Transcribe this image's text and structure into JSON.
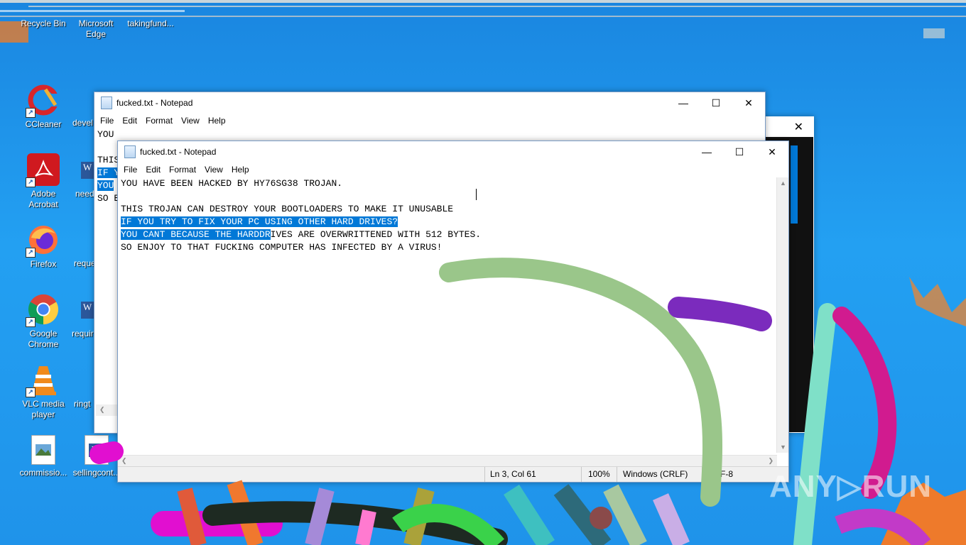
{
  "desktop": {
    "icons": [
      {
        "label": "Recycle Bin",
        "icon": "recycle-bin-icon"
      },
      {
        "label": "Microsoft Edge",
        "icon": "edge-icon"
      },
      {
        "label": "takingfund...",
        "icon": "word-document-icon"
      },
      {
        "label": "CCleaner",
        "icon": "ccleaner-icon"
      },
      {
        "label": "Adobe Acrobat",
        "icon": "acrobat-icon"
      },
      {
        "label": "Firefox",
        "icon": "firefox-icon"
      },
      {
        "label": "Google Chrome",
        "icon": "chrome-icon"
      },
      {
        "label": "VLC media player",
        "icon": "vlc-icon"
      },
      {
        "label": "commissio...",
        "icon": "image-file-icon"
      },
      {
        "label": "sellingcont...",
        "icon": "word-document-icon"
      }
    ],
    "partial_labels": [
      "devel",
      "need",
      "reque",
      "requir",
      "ringt"
    ]
  },
  "back_window": {
    "title": "fucked.txt - Notepad",
    "menu": [
      "File",
      "Edit",
      "Format",
      "View",
      "Help"
    ],
    "lines": [
      "YOU",
      "",
      "THIS",
      "IF Y",
      "YOU",
      "SO E"
    ]
  },
  "front_window": {
    "title": "fucked.txt - Notepad",
    "menu": [
      "File",
      "Edit",
      "Format",
      "View",
      "Help"
    ],
    "lines": [
      {
        "text": "YOU HAVE BEEN HACKED BY HY76SG38 TROJAN.",
        "selected": "",
        "rest": ""
      },
      {
        "text": "",
        "selected": "",
        "rest": ""
      },
      {
        "text": "THIS TROJAN CAN DESTROY YOUR BOOTLOADERS TO MAKE IT UNUSABLE",
        "selected": "",
        "rest": ""
      },
      {
        "text": "",
        "selected": "IF YOU TRY TO FIX YOUR PC USING OTHER HARD DRIVES?",
        "rest": ""
      },
      {
        "text": "",
        "selected": "YOU CANT BECAUSE THE HARDDR",
        "rest": "IVES ARE OVERWRITTENED WITH 512 BYTES."
      },
      {
        "text": "SO ENJOY TO THAT FUCKING COMPUTER HAS INFECTED BY A VIRUS!",
        "selected": "",
        "rest": ""
      }
    ],
    "status": {
      "position": "Ln 3, Col 61",
      "zoom": "100%",
      "line_ending": "Windows (CRLF)",
      "encoding": "UTF-8"
    }
  },
  "watermark": "ANY▷RUN",
  "colors": {
    "desktop": "#1e8fe6",
    "selection": "#0078d7",
    "scribble_green": "#9ac68a",
    "scribble_purple": "#7b2bbd",
    "scribble_magenta": "#d11b8f",
    "scribble_teal": "#7fe0c8"
  }
}
